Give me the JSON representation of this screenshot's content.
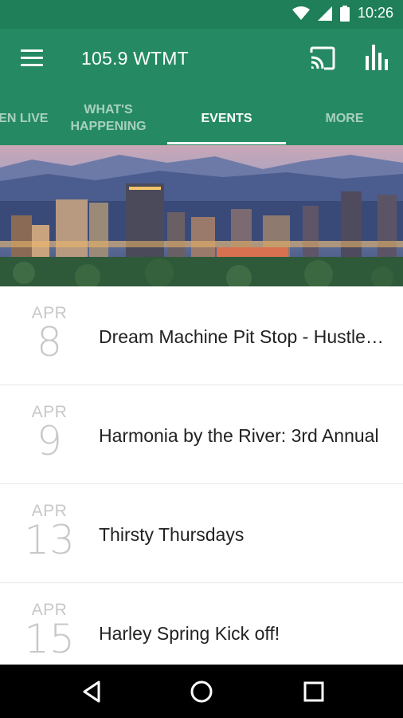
{
  "status_bar": {
    "time": "10:26"
  },
  "app_bar": {
    "title": "105.9 WTMT"
  },
  "tabs": [
    {
      "label": "LISTEN LIVE",
      "active": false
    },
    {
      "label": "WHAT'S HAPPENING",
      "active": false
    },
    {
      "label": "EVENTS",
      "active": true
    },
    {
      "label": "MORE",
      "active": false
    }
  ],
  "events": [
    {
      "month": "APR",
      "day": "8",
      "title": "Dream Machine Pit Stop - Hustle Inn"
    },
    {
      "month": "APR",
      "day": "9",
      "title": "Harmonia by the River: 3rd Annual"
    },
    {
      "month": "APR",
      "day": "13",
      "title": "Thirsty Thursdays"
    },
    {
      "month": "APR",
      "day": "15",
      "title": "Harley Spring Kick off!"
    }
  ],
  "colors": {
    "app_bar": "#258a63",
    "status_bar": "#1e7f58",
    "date_text": "#c8c8c8"
  }
}
